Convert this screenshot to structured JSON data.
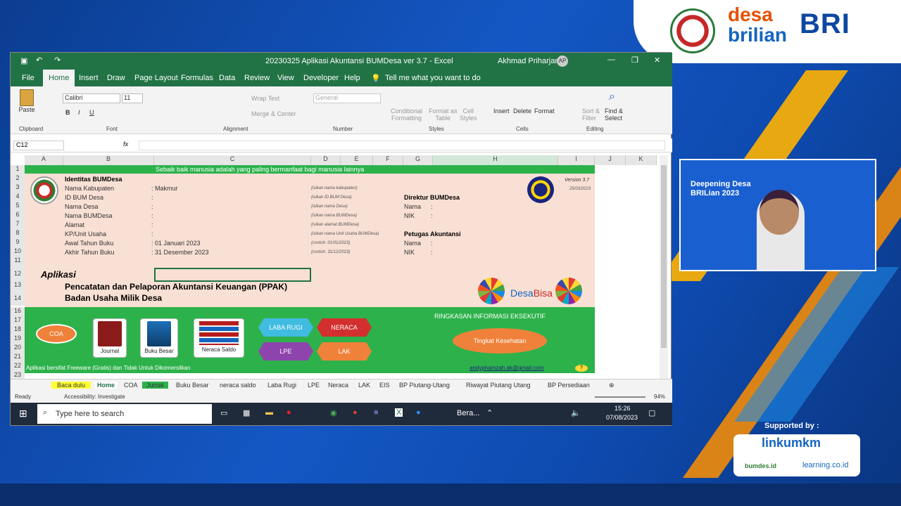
{
  "excel": {
    "window_title": "20230325 Aplikasi Akuntansi BUMDesa ver 3.7  -  Excel",
    "user_name": "Akhmad Priharjanto",
    "user_initials": "AP",
    "menu": [
      "File",
      "Home",
      "Insert",
      "Draw",
      "Page Layout",
      "Formulas",
      "Data",
      "Review",
      "View",
      "Developer",
      "Help"
    ],
    "tell_me": "Tell me what you want to do",
    "ribbon": {
      "paste": "Paste",
      "clipboard": "Clipboard",
      "font_name": "Calibri",
      "font_size": "11",
      "font": "Font",
      "wrap_text": "Wrap Text",
      "merge_center": "Merge & Center",
      "alignment": "Alignment",
      "number_format": "General",
      "number": "Number",
      "conditional_formatting_1": "Conditional",
      "conditional_formatting_2": "Formatting",
      "format_as_table_1": "Format as",
      "format_as_table_2": "Table",
      "cell_styles_1": "Cell",
      "cell_styles_2": "Styles",
      "styles": "Styles",
      "insert": "Insert",
      "delete": "Delete",
      "format": "Format",
      "cells": "Cells",
      "sort_filter_1": "Sort &",
      "sort_filter_2": "Filter",
      "find_select_1": "Find &",
      "find_select_2": "Select",
      "editing": "Editing"
    },
    "name_box": "C12",
    "columns": [
      "A",
      "B",
      "C",
      "D",
      "E",
      "F",
      "G",
      "H",
      "I",
      "J",
      "K"
    ],
    "rows": [
      "1",
      "2",
      "3",
      "4",
      "5",
      "6",
      "7",
      "8",
      "9",
      "10",
      "11",
      "12",
      "13",
      "14",
      "16",
      "17",
      "18",
      "19",
      "20",
      "21",
      "22",
      "23"
    ],
    "motto": "Sebaik baik manusia adalah yang paling bermanfaat bagi manusia lainnya",
    "identity_title": "Identitas BUMDesa",
    "fields": [
      {
        "label": "Nama Kabupaten",
        "value": ": Makmur",
        "hint": "(isikan nama kabupaten)"
      },
      {
        "label": "ID BUM Desa",
        "value": ":",
        "hint": "(isikan ID BUM Desa)"
      },
      {
        "label": "Nama Desa",
        "value": ":",
        "hint": "(isikan nama Desa)"
      },
      {
        "label": "Nama BUMDesa",
        "value": ":",
        "hint": "(isikan nama BUMDesa)"
      },
      {
        "label": "Alamat",
        "value": ":",
        "hint": "(isikan alamat BUMDesa)"
      },
      {
        "label": "KP/Unit Usaha",
        "value": ":",
        "hint": "(isikan nama Unit Usaha BUMDesa)"
      },
      {
        "label": "Awal Tahun Buku",
        "value": ": 01 Januari 2023",
        "hint": "(contoh: 01/01/2023)"
      },
      {
        "label": "Akhir Tahun Buku",
        "value": ": 31 Desember 2023",
        "hint": "(contoh: 31/12/2023)"
      }
    ],
    "direktur_title": "Direktur BUMDesa",
    "petugas_title": "Petugas Akuntansi",
    "nama": "Nama",
    "nik": "NIK",
    "colon": ":",
    "version": "Version 3.7",
    "version_date": "25/03/2023",
    "aplikasi": "Aplikasi",
    "app_line1": "Pencatatan dan Pelaporan Akuntansi Keuangan (PPAK)",
    "app_line2": "Badan Usaha Milik Desa",
    "desabisa_1": "Desa",
    "desabisa_2": "Bisa",
    "buttons": {
      "coa": "COA",
      "journal": "Journal",
      "buku_besar": "Buku Besar",
      "neraca_saldo": "Neraca Saldo",
      "laba_rugi": "LABA RUGI",
      "neraca": "NERACA",
      "lpe": "LPE",
      "lak": "LAK"
    },
    "ringkasan": "RINGKASAN INFORMASI EKSEKUTIF",
    "tingkat_kesehatan": "Tingkat Kesehatan",
    "footer_note": "Aplikasi bersifat Freeware (Gratis) dan Tidak Untuk Dikomersilkan",
    "email": "andyphamzah.ak@gmail.com",
    "help_glyph": "?",
    "sheet_tabs": [
      "Baca dulu",
      "Home",
      "COA",
      "Jurnal",
      "Buku Besar",
      "neraca saldo",
      "Laba Rugi",
      "LPE",
      "Neraca",
      "LAK",
      "EIS",
      "BP Piutang-Utang",
      "Riwayat Piutang Utang",
      "BP Persediaan"
    ],
    "status_ready": "Ready",
    "accessibility": "Accessibility: Investigate",
    "zoom": "94%"
  },
  "taskbar": {
    "search_placeholder": "Type here to search",
    "bera": "Bera...",
    "time": "15:26",
    "date": "07/08/2023"
  },
  "branding": {
    "desa": "desa",
    "brilian": "brilian",
    "bri": "BRI"
  },
  "video": {
    "title": "Deepening Desa BRILian 2023"
  },
  "supported_by": "Supported by :",
  "sponsors": {
    "linkumkm": "linkumkm",
    "bumdes": "bumdes.id",
    "learning": "learning.co.id"
  }
}
